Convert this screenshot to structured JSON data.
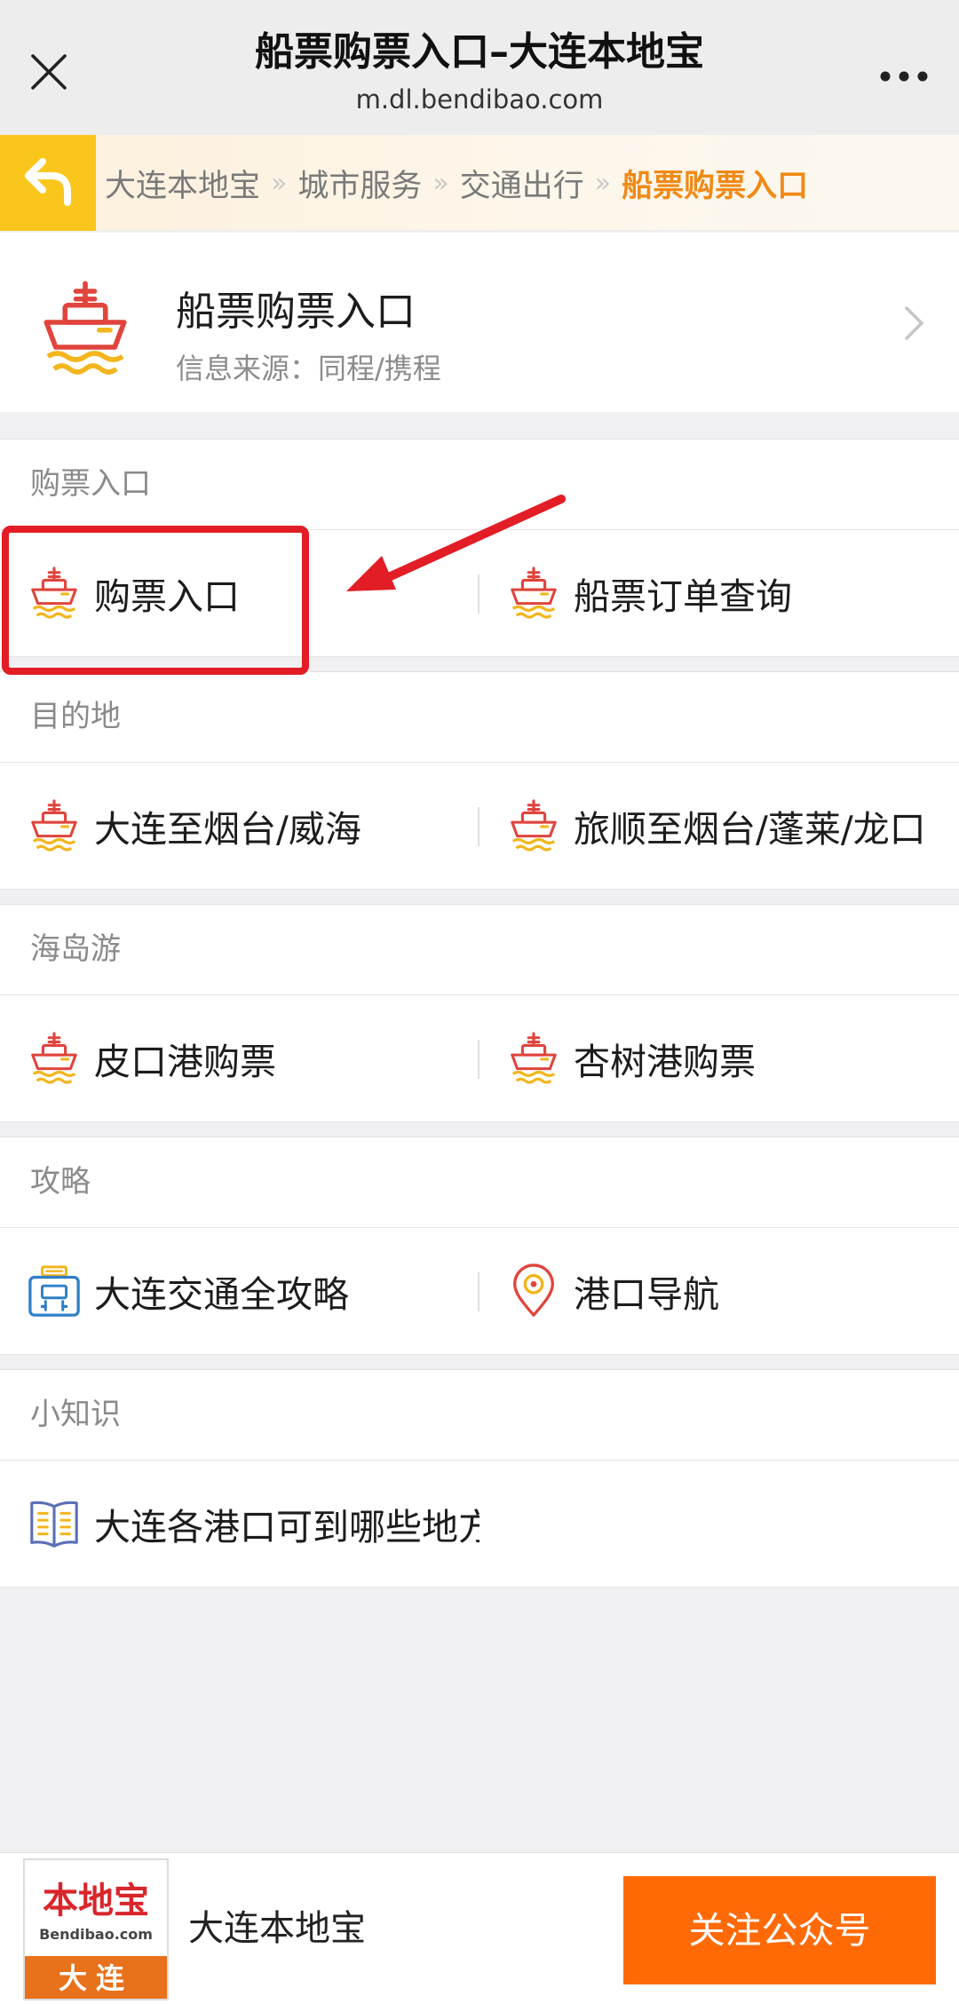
{
  "topbar": {
    "title": "船票购票入口–大连本地宝",
    "url": "m.dl.bendibao.com"
  },
  "breadcrumb": {
    "items": [
      "大连本地宝",
      "城市服务",
      "交通出行",
      "船票购票入口"
    ],
    "separator": "»"
  },
  "header": {
    "title": "船票购票入口",
    "subtitle": "信息来源：同程/携程"
  },
  "sections": [
    {
      "label": "购票入口",
      "left": "购票入口",
      "right": "船票订单查询"
    },
    {
      "label": "目的地",
      "left": "大连至烟台/威海",
      "right": "旅顺至烟台/蓬莱/龙口"
    },
    {
      "label": "海岛游",
      "left": "皮口港购票",
      "right": "杏树港购票"
    },
    {
      "label": "攻略",
      "left": "大连交通全攻略",
      "right": "港口导航"
    },
    {
      "label": "小知识",
      "left": "大连各港口可到哪些地方"
    }
  ],
  "bottom": {
    "logo_cn": "本地宝",
    "logo_en": "Bendibao.com",
    "logo_city": "大连",
    "brand_name": "大连本地宝",
    "follow_label": "关注公众号"
  },
  "colors": {
    "accent_orange": "#f08a16",
    "follow_button": "#ff6a07",
    "highlight_red": "#e21d25",
    "back_yellow": "#fbc61c"
  }
}
